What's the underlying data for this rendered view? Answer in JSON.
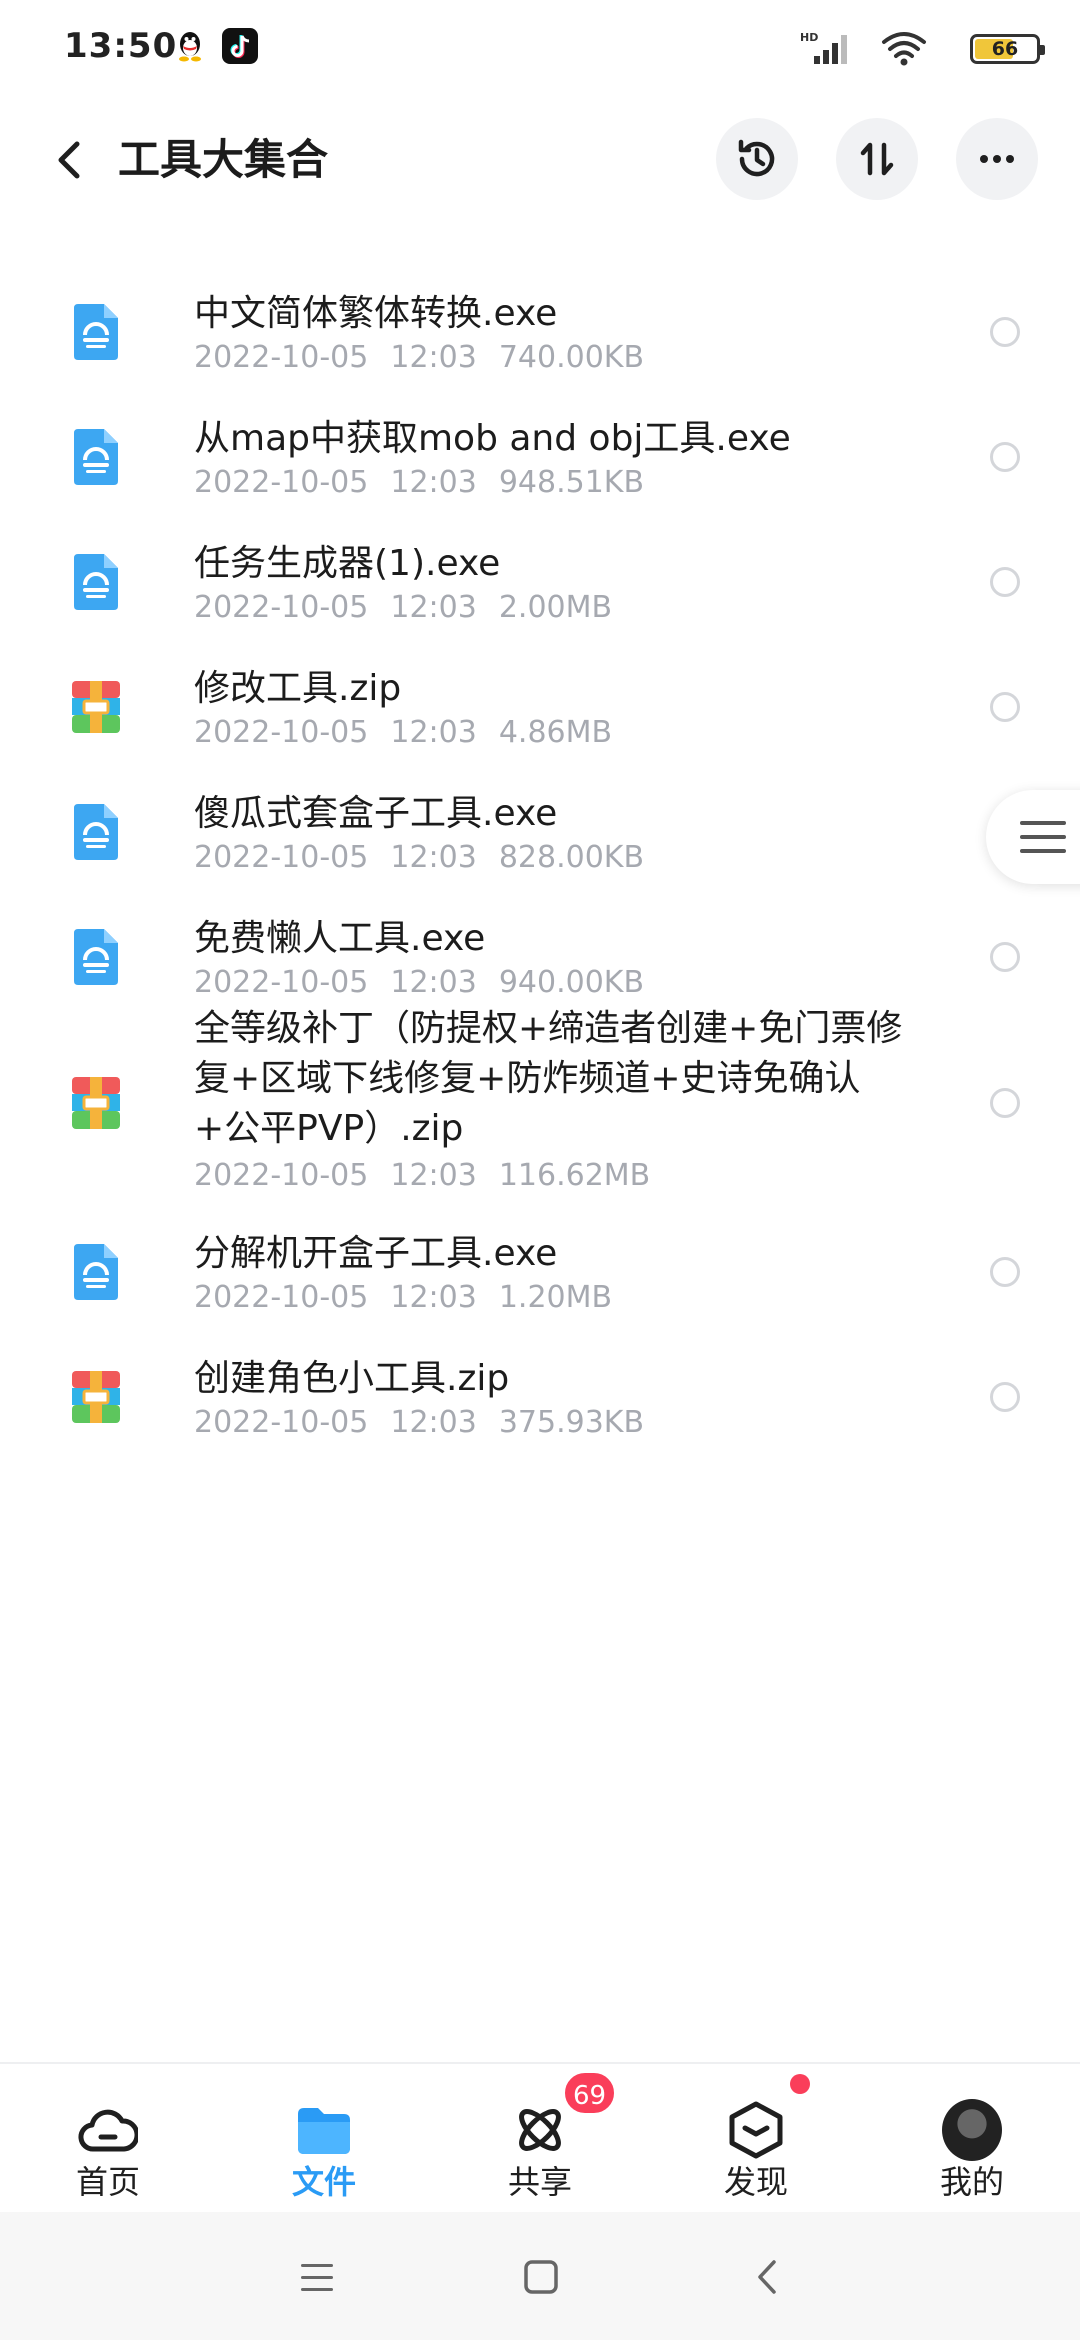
{
  "status_bar": {
    "time": "13:50",
    "network": "HD",
    "battery": "66",
    "battery_level_percent": 66,
    "icons": [
      "qq-icon",
      "tiktok-icon",
      "signal-icon",
      "wifi-icon",
      "battery-icon"
    ]
  },
  "header": {
    "title": "工具大集合",
    "icons": [
      "back-arrow-icon",
      "history-icon",
      "sort-icon",
      "more-icon"
    ]
  },
  "files": [
    {
      "name": "中文简体繁体转换.exe",
      "date": "2022-10-05",
      "time": "12:03",
      "size": "740.00KB",
      "type": "exe"
    },
    {
      "name": "从map中获取mob and obj工具.exe",
      "date": "2022-10-05",
      "time": "12:03",
      "size": "948.51KB",
      "type": "exe"
    },
    {
      "name": "任务生成器(1).exe",
      "date": "2022-10-05",
      "time": "12:03",
      "size": "2.00MB",
      "type": "exe"
    },
    {
      "name": "修改工具.zip",
      "date": "2022-10-05",
      "time": "12:03",
      "size": "4.86MB",
      "type": "zip"
    },
    {
      "name": "傻瓜式套盒子工具.exe",
      "date": "2022-10-05",
      "time": "12:03",
      "size": "828.00KB",
      "type": "exe"
    },
    {
      "name": "免费懒人工具.exe",
      "date": "2022-10-05",
      "time": "12:03",
      "size": "940.00KB",
      "type": "exe"
    },
    {
      "name": "全等级补丁（防提权+缔造者创建+免门票修复+区域下线修复+防炸频道+史诗免确认+公平PVP）.zip",
      "date": "2022-10-05",
      "time": "12:03",
      "size": "116.62MB",
      "type": "zip"
    },
    {
      "name": "分解机开盒子工具.exe",
      "date": "2022-10-05",
      "time": "12:03",
      "size": "1.20MB",
      "type": "exe"
    },
    {
      "name": "创建角色小工具.zip",
      "date": "2022-10-05",
      "time": "12:03",
      "size": "375.93KB",
      "type": "zip"
    }
  ],
  "bottom_nav": {
    "items": [
      {
        "label": "首页",
        "icon": "cloud-icon"
      },
      {
        "label": "文件",
        "icon": "folder-icon",
        "active": true
      },
      {
        "label": "共享",
        "icon": "share-atom-icon"
      },
      {
        "label": "发现",
        "icon": "discover-box-icon"
      },
      {
        "label": "我的",
        "icon": "avatar"
      }
    ],
    "share_badge": "69"
  },
  "colors": {
    "accent": "#2a9bf5",
    "exe_icon": "#3da7f2",
    "badge": "#fa3e5a",
    "meta_text": "#a6a9b0"
  }
}
